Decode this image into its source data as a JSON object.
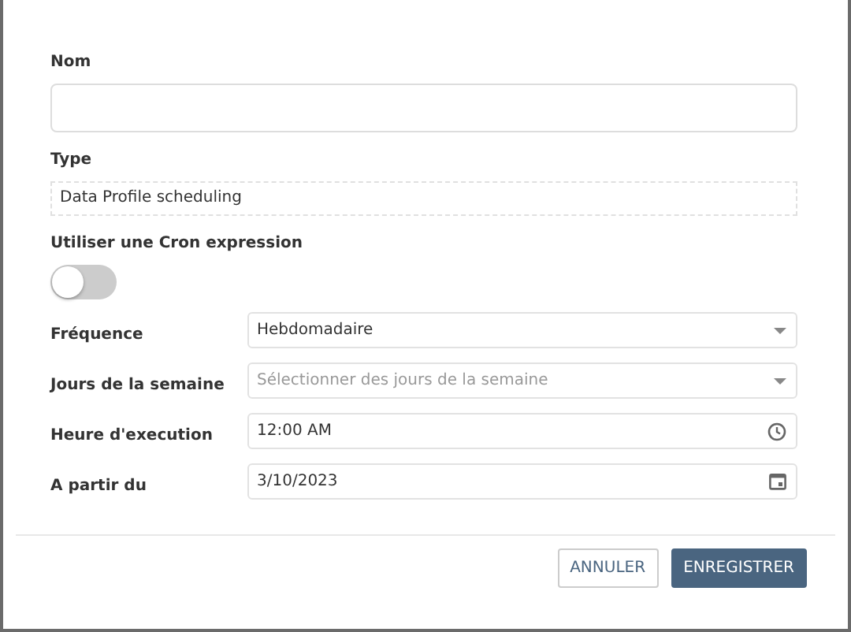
{
  "name_field": {
    "label": "Nom"
  },
  "type_field": {
    "label": "Type",
    "value": "Data Profile scheduling"
  },
  "cron": {
    "label": "Utiliser une Cron expression",
    "on": false
  },
  "schedule": [
    {
      "label": "Fréquence",
      "kind": "select",
      "value": "Hebdomadaire"
    },
    {
      "label": "Jours de la semaine",
      "kind": "select",
      "placeholder": "Sélectionner des jours de la semaine"
    },
    {
      "label": "Heure d'execution",
      "kind": "time",
      "value": "12:00 AM"
    },
    {
      "label": "A partir du",
      "kind": "date",
      "value": "3/10/2023"
    }
  ],
  "buttons": [
    {
      "label": "ANNULER",
      "kind": "secondary"
    },
    {
      "label": "ENREGISTRER",
      "kind": "primary"
    }
  ]
}
